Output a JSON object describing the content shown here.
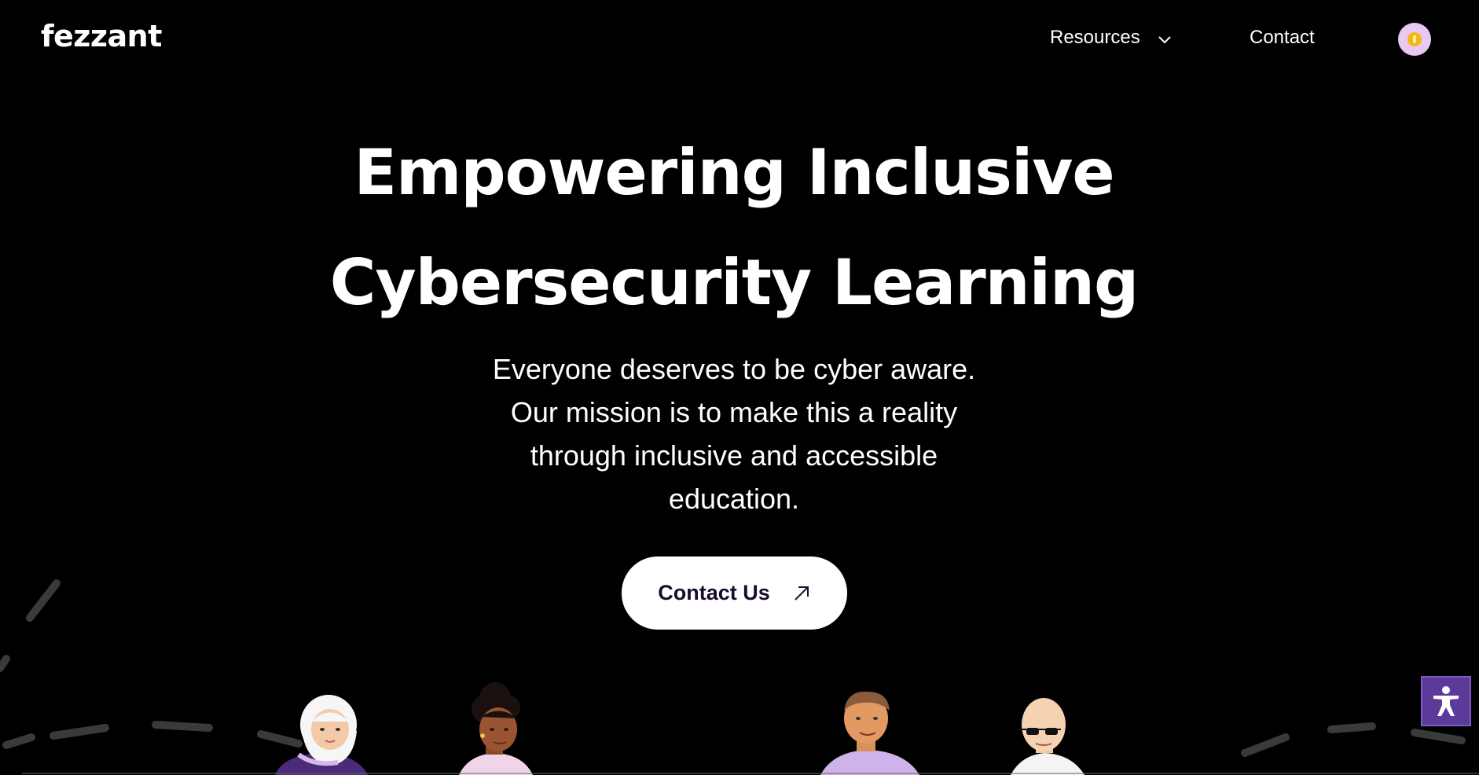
{
  "header": {
    "logo": "fezzant",
    "nav": {
      "resources_label": "Resources",
      "contact_label": "Contact"
    },
    "theme_toggle_icon": "sun-icon"
  },
  "hero": {
    "title_line1": "Empowering Inclusive",
    "title_line2": "Cybersecurity Learning",
    "subtitle_line1": "Everyone deserves to be cyber aware.",
    "subtitle_line2": "Our mission is to make this a reality",
    "subtitle_line3": "through inclusive and accessible",
    "subtitle_line4": "education.",
    "cta_label": "Contact Us"
  },
  "accessibility_button_icon": "accessibility-icon",
  "colors": {
    "background": "#000000",
    "text": "#ffffff",
    "accent_purple": "#5b3a9a",
    "toggle_bg": "#e9c8f2"
  }
}
